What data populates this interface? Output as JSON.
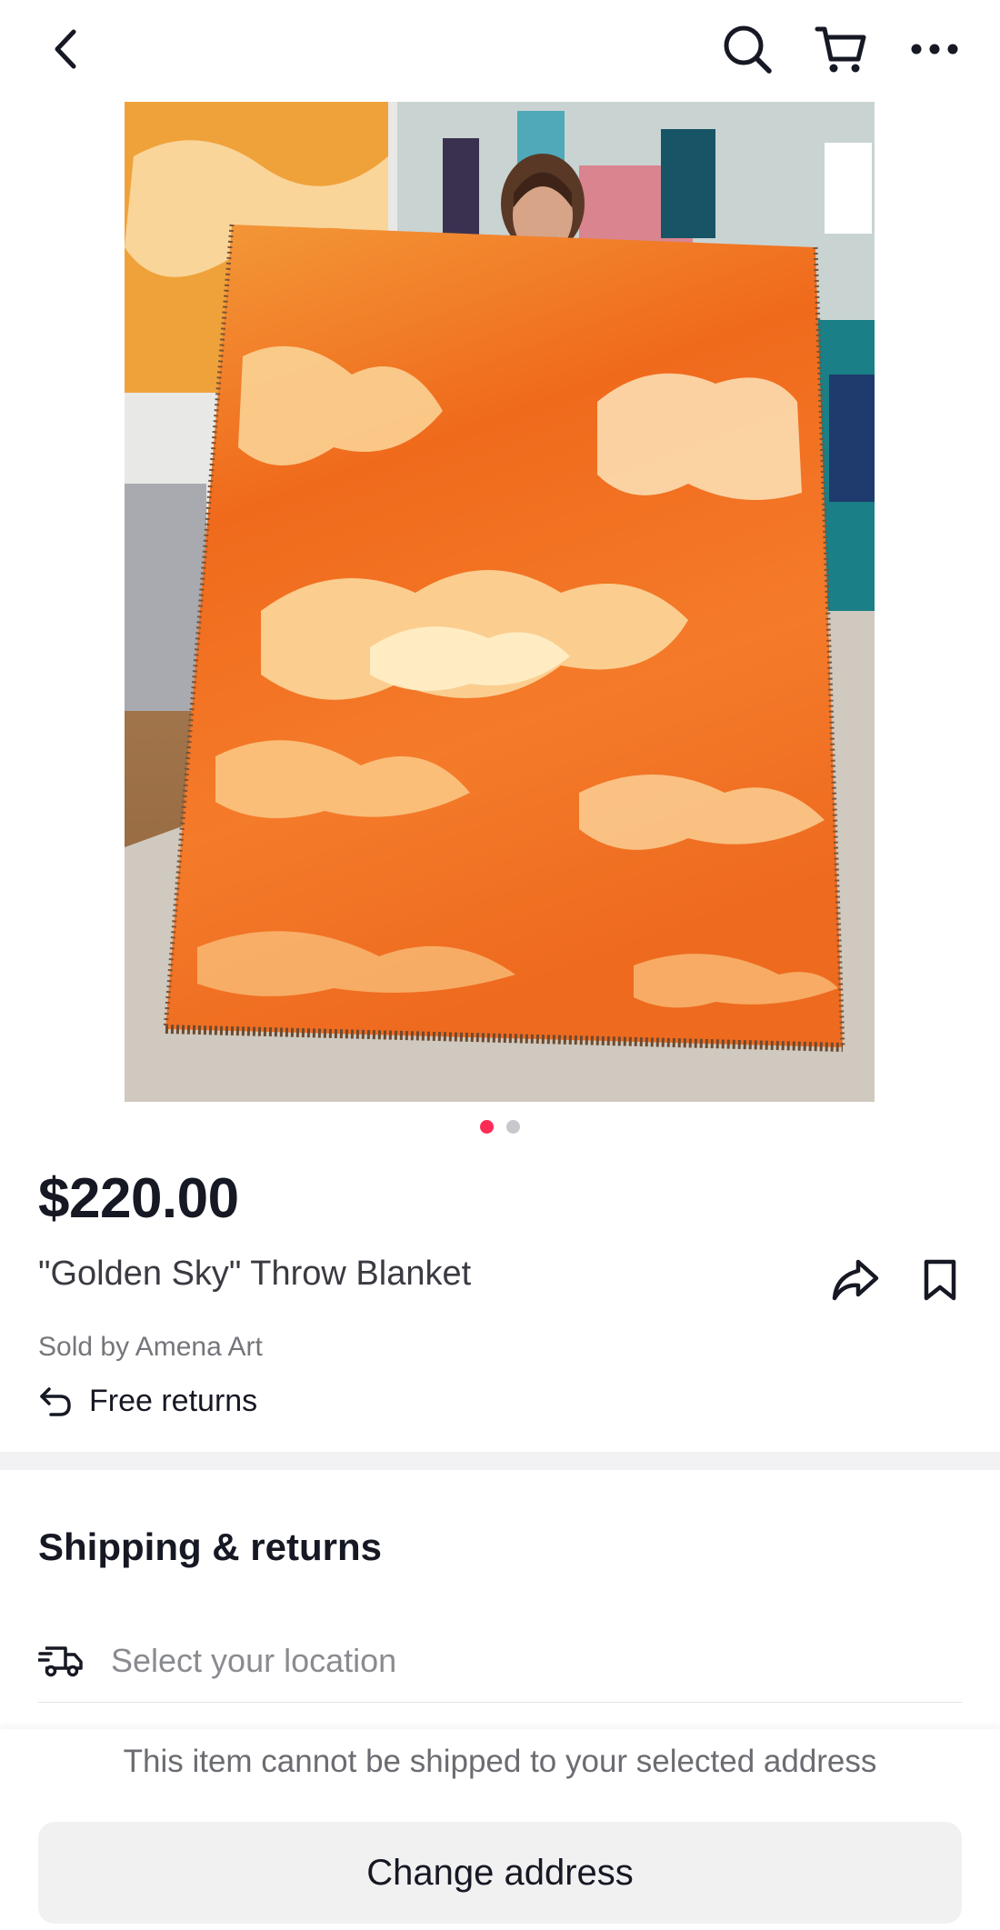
{
  "header": {
    "back_icon": "chevron-left-icon",
    "search_icon": "search-icon",
    "cart_icon": "cart-icon",
    "more_icon": "more-horizontal-icon"
  },
  "gallery": {
    "image_count": 2,
    "active_index": 0
  },
  "product": {
    "price": "$220.00",
    "title": "\"Golden Sky\" Throw Blanket",
    "seller": "Sold by Amena Art",
    "returns_label": "Free returns",
    "share_icon": "share-icon",
    "bookmark_icon": "bookmark-icon"
  },
  "shipping": {
    "heading": "Shipping & returns",
    "location_placeholder": "Select your location"
  },
  "footer": {
    "notice": "This item cannot be shipped to your selected address",
    "change_address_label": "Change address"
  },
  "colors": {
    "accent": "#fe2c55",
    "text_primary": "#161823",
    "button_bg": "#f1f1f2"
  }
}
